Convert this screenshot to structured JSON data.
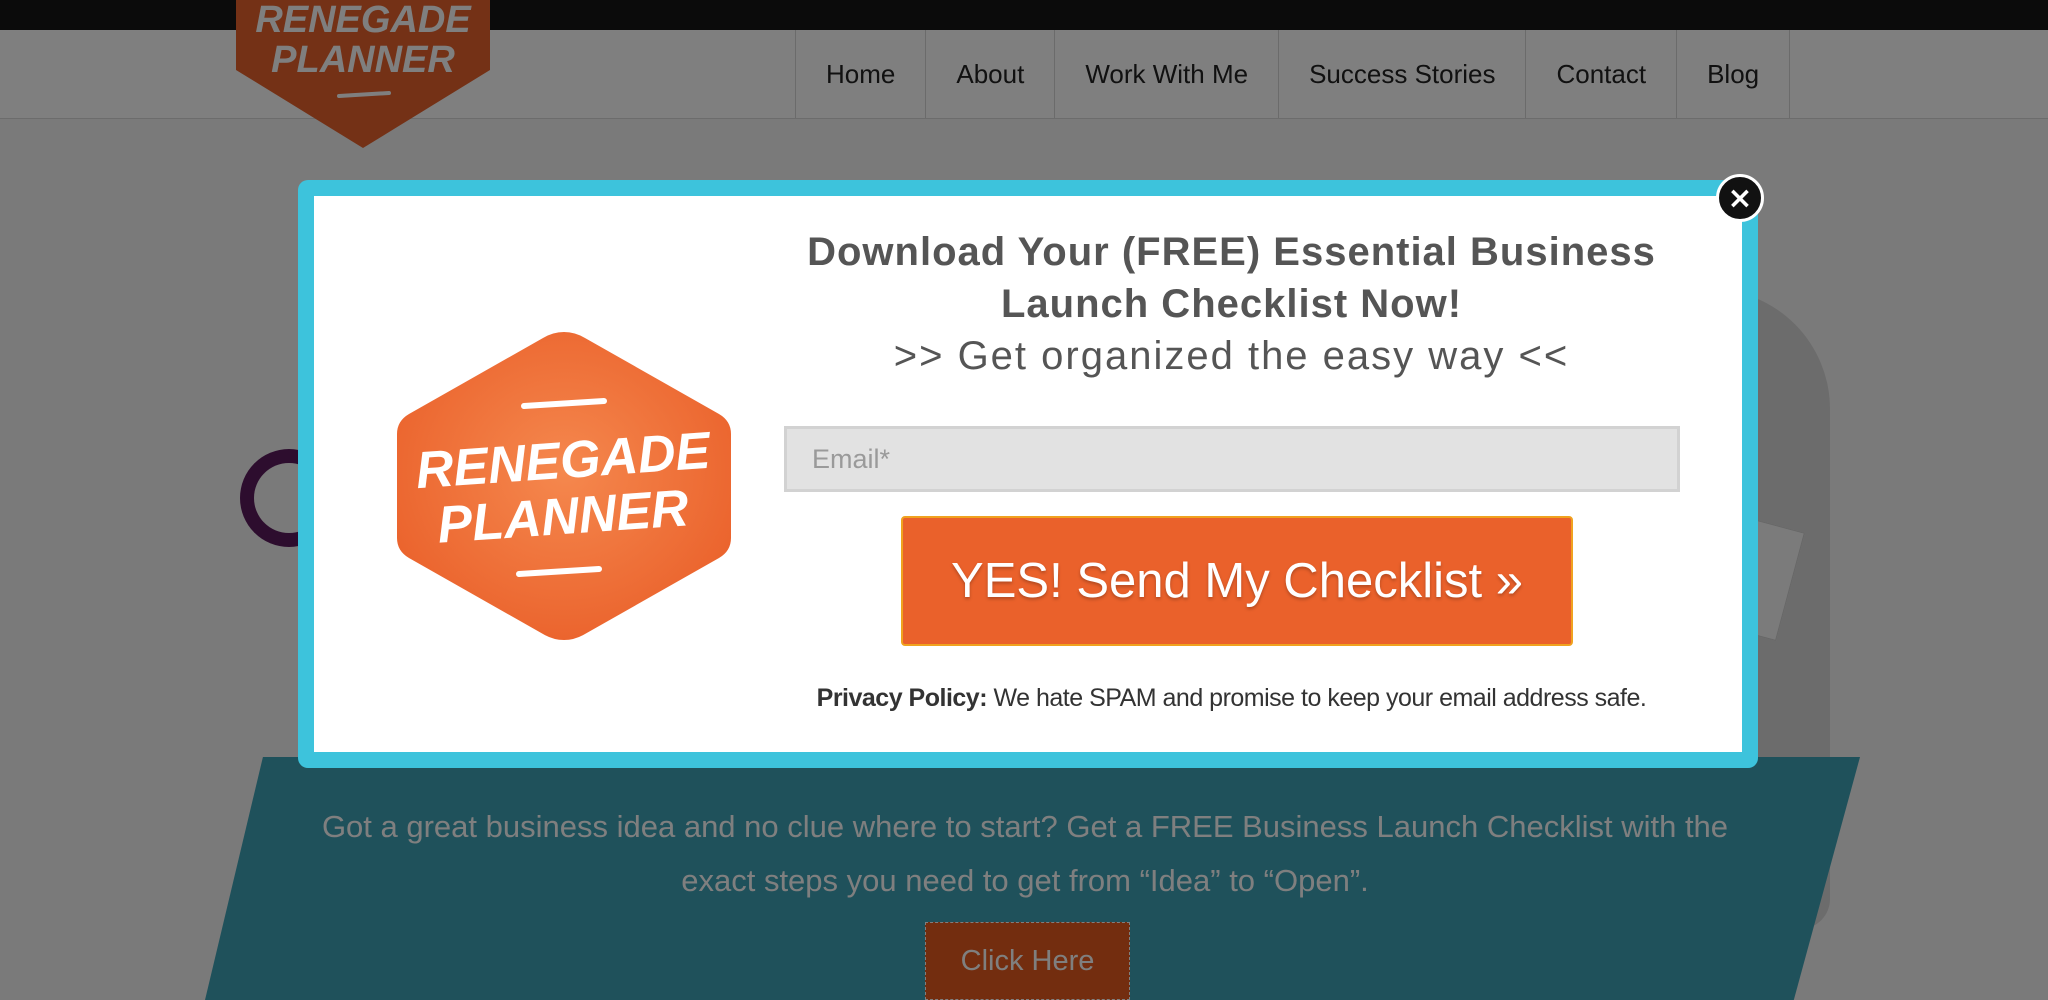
{
  "header": {
    "logo_line1": "RENEGADE",
    "logo_line2": "PLANNER",
    "nav": [
      "Home",
      "About",
      "Work With Me",
      "Success Stories",
      "Contact",
      "Blog"
    ]
  },
  "hero": {
    "banner_text": "Got a great business idea and no clue where to start? Get a FREE Business Launch Checklist with the exact steps you need to get from “Idea” to “Open”.",
    "cta_label": "Click Here"
  },
  "popup": {
    "logo_line1": "RENEGADE",
    "logo_line2": "PLANNER",
    "headline": "Download Your (FREE) Essential Business Launch Checklist Now!",
    "subheadline": ">> Get organized the easy way <<",
    "email_placeholder": "Email*",
    "email_value": "",
    "submit_label": "YES! Send My Checklist »",
    "privacy_label": "Privacy Policy:",
    "privacy_text": " We hate SPAM and promise to keep your email address safe.",
    "close_icon": "×"
  },
  "colors": {
    "brand_orange": "#ea612b",
    "popup_border": "#3dc3dc",
    "banner_teal": "#3ea3b7",
    "top_bar": "#171717"
  },
  "icons": [
    "close-icon"
  ]
}
